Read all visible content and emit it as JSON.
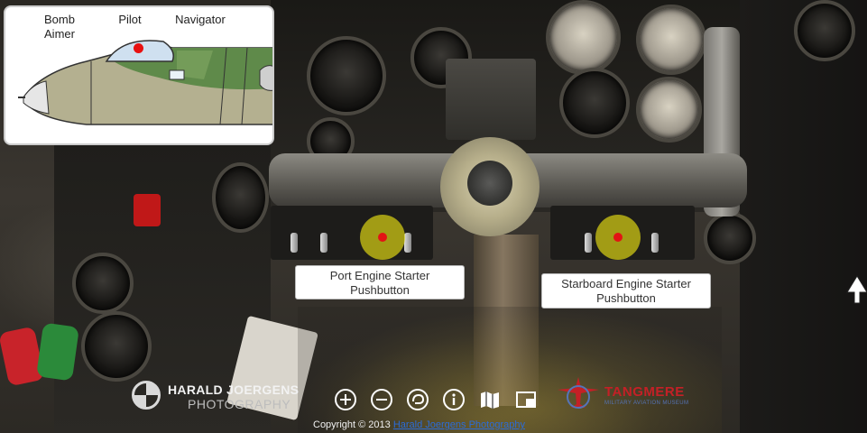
{
  "inset": {
    "crew_labels": [
      "Bomb\nAimer",
      "Pilot",
      "Navigator"
    ]
  },
  "hotspots": [
    {
      "label_line1": "Port Engine Starter",
      "label_line2": "Pushbutton"
    },
    {
      "label_line1": "Starboard Engine Starter",
      "label_line2": "Pushbutton"
    }
  ],
  "branding": {
    "name": "HARALD JOERGENS",
    "sub": "PHOTOGRAPHY",
    "partner": "TANGMERE",
    "partner_sub": "MILITARY AVIATION MUSEUM"
  },
  "toolbar": {
    "icons": [
      "zoom-in-icon",
      "zoom-out-icon",
      "autorotate-icon",
      "info-icon",
      "map-icon",
      "fullscreen-icon"
    ]
  },
  "footer": {
    "copyright_prefix": "Copyright © 2013",
    "copyright_link": "Harald Joergens Photography"
  },
  "colors": {
    "hotspot": "#d6ce14",
    "hotspot_dot": "#e21414",
    "link": "#2b6cd8",
    "partner_red": "#c42026"
  }
}
